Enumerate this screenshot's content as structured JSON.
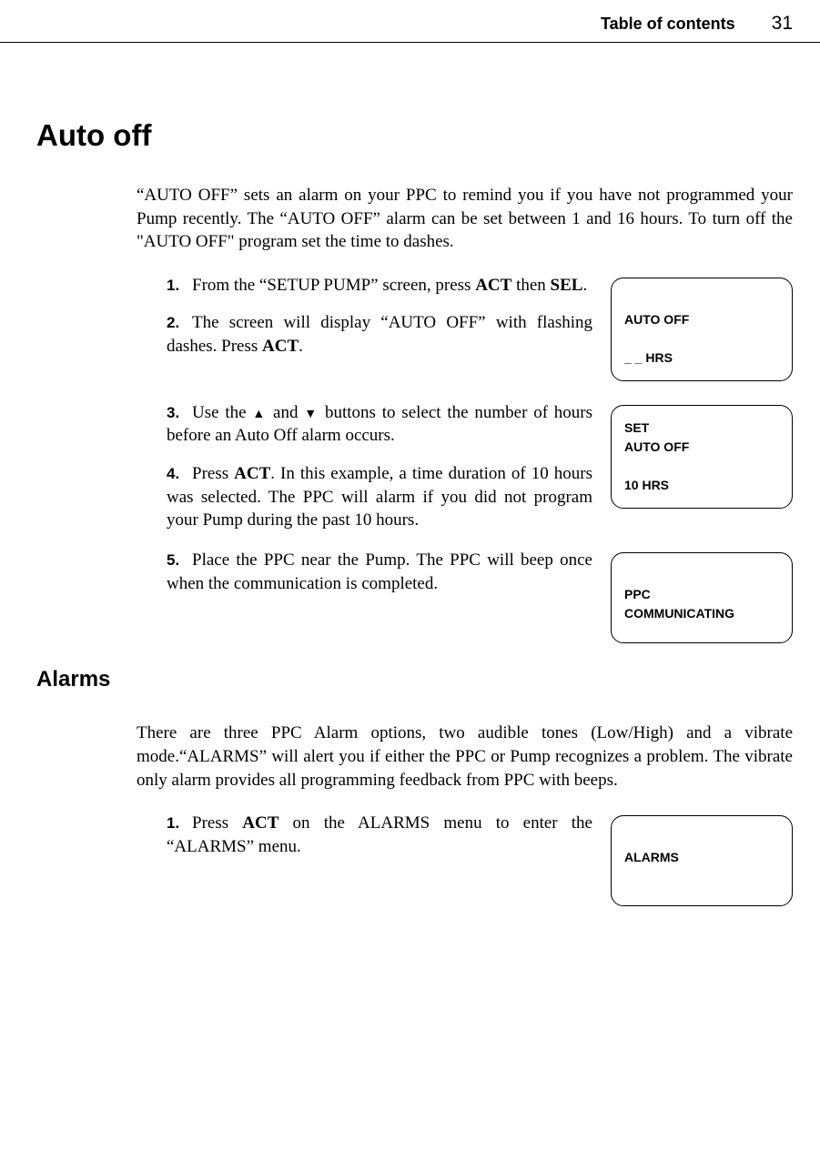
{
  "header": {
    "toc": "Table of contents",
    "page": "31"
  },
  "section1": {
    "title": "Auto off",
    "intro": "“AUTO OFF” sets an alarm on your PPC to remind you if you have not programmed your Pump recently. The “AUTO OFF” alarm can be set between 1 and 16 hours. To turn off the \"AUTO OFF\" program set the time to dashes.",
    "steps": {
      "s1": {
        "num": "1.",
        "pre": "From the “SETUP PUMP” screen, press ",
        "b1": "ACT",
        "mid": " then ",
        "b2": "SEL",
        "post": "."
      },
      "s2": {
        "num": "2.",
        "pre": "The screen will display “AUTO OFF” with flashing dashes. Press ",
        "b1": "ACT",
        "post": "."
      },
      "s3": {
        "num": "3.",
        "pre": "Use the ",
        "upIcon": "▲",
        "mid1": " and ",
        "downIcon": "▼",
        "post": " buttons to select the number of hours before an Auto Off alarm occurs."
      },
      "s4": {
        "num": "4.",
        "pre": "Press ",
        "b1": "ACT",
        "post": ". In this example, a time duration of 10 hours was selected. The PPC will alarm if you did not program your Pump during the past 10 hours."
      },
      "s5": {
        "num": "5.",
        "text": "Place the PPC near the Pump. The PPC will beep once when the communication is completed."
      }
    },
    "screens": {
      "a": "\nAUTO OFF\n\n    _ _ HRS",
      "b": "SET\nAUTO OFF\n\n    10 HRS",
      "c": "\nPPC\nCOMMUNICATING\n"
    }
  },
  "section2": {
    "title": "Alarms",
    "intro": "There are three PPC Alarm options, two audible tones (Low/High) and a vibrate mode.“ALARMS” will alert you if either the PPC or Pump recognizes a problem. The vibrate only alarm provides all programming feedback from PPC with beeps.",
    "steps": {
      "s1": {
        "num": "1.",
        "pre": "Press ",
        "b1": "ACT",
        "post": " on the ALARMS menu to enter the “ALARMS” menu."
      }
    },
    "screens": {
      "a": "\nALARMS\n\n"
    }
  }
}
